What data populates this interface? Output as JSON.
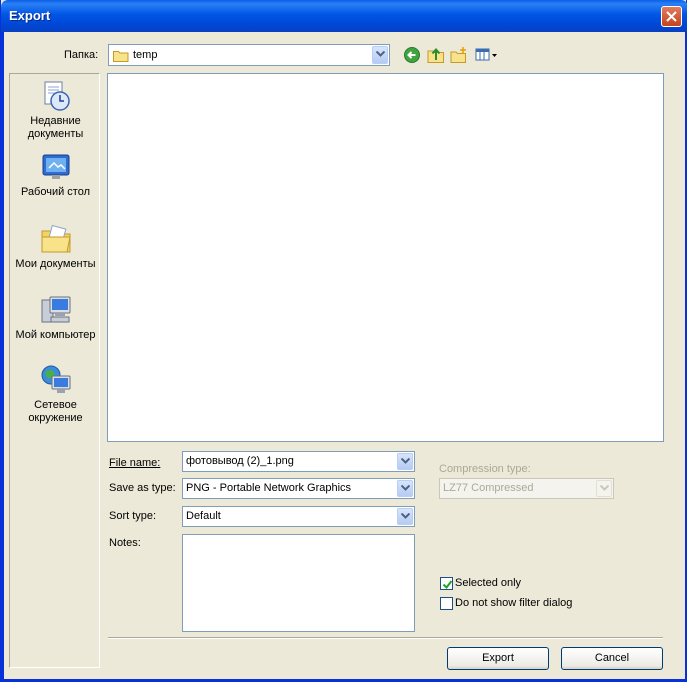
{
  "window": {
    "title": "Export"
  },
  "toolbar": {
    "folder_label": "Папка:",
    "folder_value": "temp"
  },
  "places": [
    {
      "label": "Недавние документы",
      "icon": "recent-documents-icon"
    },
    {
      "label": "Рабочий стол",
      "icon": "desktop-icon"
    },
    {
      "label": "Мои документы",
      "icon": "my-documents-icon"
    },
    {
      "label": "Мой компьютер",
      "icon": "my-computer-icon"
    },
    {
      "label": "Сетевое окружение",
      "icon": "network-places-icon"
    }
  ],
  "form": {
    "file_name_label": "File name:",
    "file_name_value": "фотовывод (2)_1.png",
    "save_as_label": "Save as type:",
    "save_as_value": "PNG - Portable Network Graphics",
    "sort_label": "Sort type:",
    "sort_value": "Default",
    "notes_label": "Notes:",
    "notes_value": "",
    "compression_label": "Compression type:",
    "compression_value": "LZ77 Compressed",
    "selected_only_label": "Selected only",
    "selected_only_checked": true,
    "no_filter_label": "Do not show filter dialog",
    "no_filter_checked": false
  },
  "buttons": {
    "export": "Export",
    "cancel": "Cancel"
  },
  "colors": {
    "titlebar": "#0054E3",
    "face": "#ECE9D8",
    "close": "#C5421E",
    "field_border": "#7F9DB9"
  }
}
